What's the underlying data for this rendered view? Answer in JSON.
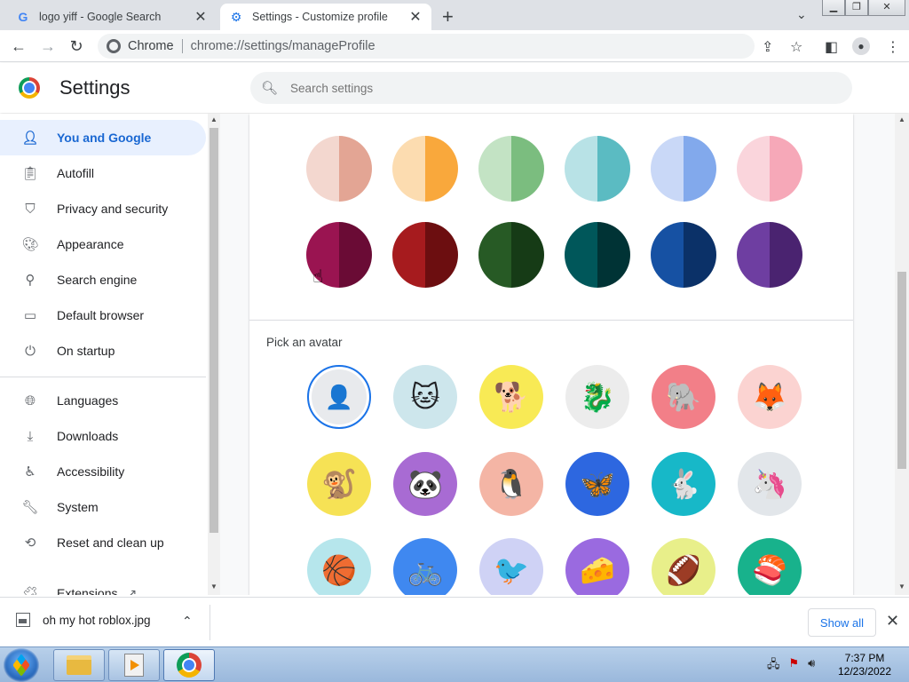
{
  "tabs": [
    {
      "title": "logo yiff - Google Search",
      "favicon": "G"
    },
    {
      "title": "Settings - Customize profile",
      "favicon": "gear-icon"
    }
  ],
  "toolbar": {
    "site_chip": "Chrome",
    "url": "chrome://settings/manageProfile"
  },
  "header": {
    "title": "Settings",
    "search_placeholder": "Search settings"
  },
  "sidebar": {
    "items": [
      {
        "label": "You and Google",
        "icon": "person-icon",
        "active": true
      },
      {
        "label": "Autofill",
        "icon": "clipboard-icon"
      },
      {
        "label": "Privacy and security",
        "icon": "shield-icon"
      },
      {
        "label": "Appearance",
        "icon": "palette-icon"
      },
      {
        "label": "Search engine",
        "icon": "search-icon"
      },
      {
        "label": "Default browser",
        "icon": "browser-icon"
      },
      {
        "label": "On startup",
        "icon": "power-icon"
      },
      {
        "label": "Languages",
        "icon": "globe-icon"
      },
      {
        "label": "Downloads",
        "icon": "download-icon"
      },
      {
        "label": "Accessibility",
        "icon": "accessibility-icon"
      },
      {
        "label": "System",
        "icon": "wrench-icon"
      },
      {
        "label": "Reset and clean up",
        "icon": "history-icon"
      },
      {
        "label": "Extensions",
        "icon": "puzzle-icon"
      }
    ]
  },
  "theme_colors": {
    "light_row": [
      [
        "#f3d7cf",
        "#e3a594"
      ],
      [
        "#fcdcb0",
        "#f9a83c"
      ],
      [
        "#c3e3c4",
        "#7bbd7f"
      ],
      [
        "#b8e2e6",
        "#5bbbc2"
      ],
      [
        "#c9d8f7",
        "#82a9ec"
      ],
      [
        "#fad5dc",
        "#f6a8b8"
      ]
    ],
    "dark_row": [
      [
        "#9a1451",
        "#6a0b35"
      ],
      [
        "#a61b1e",
        "#6c0e10"
      ],
      [
        "#275a25",
        "#163b16"
      ],
      [
        "#00575a",
        "#003335"
      ],
      [
        "#1651a3",
        "#0b3168"
      ],
      [
        "#6e3ea1",
        "#4a2370"
      ]
    ]
  },
  "avatar_section": {
    "label": "Pick an avatar",
    "avatars": [
      {
        "name": "default-avatar",
        "icon": "person-icon",
        "bg": "#e8eaed",
        "glyph": "👤"
      },
      {
        "name": "cat",
        "bg": "#cde6ec",
        "glyph": "🐱"
      },
      {
        "name": "corgi",
        "bg": "#f8ea55",
        "glyph": "🐕"
      },
      {
        "name": "dragon",
        "bg": "#ececec",
        "glyph": "🐉"
      },
      {
        "name": "elephant",
        "bg": "#f27f88",
        "glyph": "🐘"
      },
      {
        "name": "fox",
        "bg": "#fbd3d1",
        "glyph": "🦊"
      },
      {
        "name": "monkey",
        "bg": "#f6e255",
        "glyph": "🐒"
      },
      {
        "name": "panda",
        "bg": "#a86bd3",
        "glyph": "🐼"
      },
      {
        "name": "penguin",
        "bg": "#f4b5a5",
        "glyph": "🐧"
      },
      {
        "name": "butterfly",
        "bg": "#2d67e0",
        "glyph": "🦋"
      },
      {
        "name": "rabbit",
        "bg": "#17b8c8",
        "glyph": "🐇"
      },
      {
        "name": "unicorn",
        "bg": "#e2e6ea",
        "glyph": "🦄"
      },
      {
        "name": "basketball",
        "bg": "#b6e6ec",
        "glyph": "🏀"
      },
      {
        "name": "bicycle",
        "bg": "#3f88f0",
        "glyph": "🚲"
      },
      {
        "name": "bird",
        "bg": "#cfd2f5",
        "glyph": "🐦"
      },
      {
        "name": "cheese",
        "bg": "#9a6ae0",
        "glyph": "🧀"
      },
      {
        "name": "football",
        "bg": "#e8ef8a",
        "glyph": "🏈"
      },
      {
        "name": "sushi",
        "bg": "#18b28c",
        "glyph": "🍣"
      }
    ]
  },
  "download": {
    "filename": "oh my hot roblox.jpg",
    "show_all": "Show all"
  },
  "clock": {
    "time": "7:37 PM",
    "date": "12/23/2022"
  }
}
